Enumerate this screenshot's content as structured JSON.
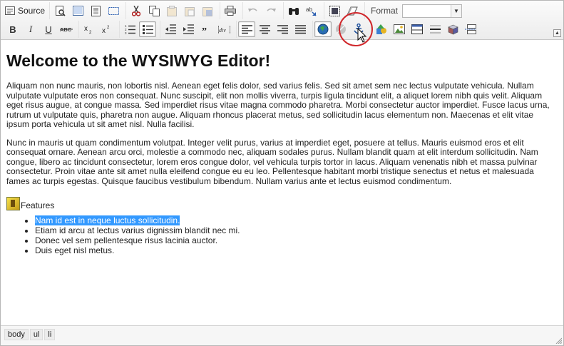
{
  "toolbar": {
    "source_label": "Source",
    "format_label": "Format",
    "format_value": ""
  },
  "content": {
    "heading": "Welcome to the WYSIWYG Editor!",
    "para1": "Aliquam non nunc mauris, non lobortis nisl. Aenean eget felis dolor, sed varius felis. Sed sit amet sem nec lectus vulputate vehicula. Nullam vulputate vulputate eros non consequat. Nunc suscipit, elit non mollis viverra, turpis ligula tincidunt elit, a aliquet lorem nibh quis velit. Aliquam eget risus augue, at congue massa. Sed imperdiet risus vitae magna commodo pharetra. Morbi consectetur auctor imperdiet. Fusce lacus urna, rutrum ut vulputate quis, pharetra non augue. Aliquam rhoncus placerat metus, sed sollicitudin lacus elementum non. Maecenas et elit vitae ipsum porta vehicula ut sit amet nisl. Nulla facilisi.",
    "para2": "Nunc in mauris ut quam condimentum volutpat. Integer velit purus, varius at imperdiet eget, posuere at tellus. Mauris euismod eros et elit consequat ornare. Aenean arcu orci, molestie a commodo nec, aliquam sodales purus. Nullam blandit quam at elit interdum sollicitudin. Nam congue, libero ac tincidunt consectetur, lorem eros congue dolor, vel vehicula turpis tortor in lacus. Aliquam venenatis nibh et massa pulvinar consectetur. Proin vitae ante sit amet nulla eleifend congue eu eu leo. Pellentesque habitant morbi tristique senectus et netus et malesuada fames ac turpis egestas. Quisque faucibus vestibulum bibendum. Nullam varius ante et lectus euismod condimentum.",
    "features_label": "Features",
    "list": [
      "Nam id est in neque luctus sollicitudin.",
      "Etiam id arcu at lectus varius dignissim blandit nec mi.",
      "Donec vel sem pellentesque risus lacinia auctor.",
      "Duis eget nisl metus."
    ]
  },
  "statusbar": {
    "path": [
      "body",
      "ul",
      "li"
    ]
  },
  "colors": {
    "selection": "#3399ff",
    "highlight_ring": "#d0282c"
  }
}
